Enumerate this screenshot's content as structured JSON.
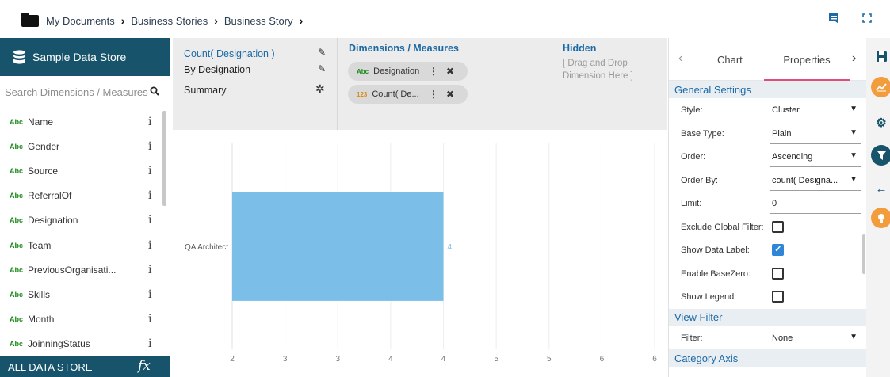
{
  "breadcrumb": [
    "My Documents",
    "Business Stories",
    "Business Story"
  ],
  "left_panel": {
    "store_title": "Sample Data Store",
    "search_placeholder": "Search Dimensions / Measures",
    "fields": [
      {
        "type": "Abc",
        "name": "Name"
      },
      {
        "type": "Abc",
        "name": "Gender"
      },
      {
        "type": "Abc",
        "name": "Source"
      },
      {
        "type": "Abc",
        "name": "ReferralOf"
      },
      {
        "type": "Abc",
        "name": "Designation"
      },
      {
        "type": "Abc",
        "name": "Team"
      },
      {
        "type": "Abc",
        "name": "PreviousOrganisati..."
      },
      {
        "type": "Abc",
        "name": "Skills"
      },
      {
        "type": "Abc",
        "name": "Month"
      },
      {
        "type": "Abc",
        "name": "JoinningStatus"
      }
    ],
    "info_glyph": "i",
    "footer_label": "ALL DATA STORE",
    "footer_fx": "fx"
  },
  "config": {
    "measure_title": "Count( Designation )",
    "by_label": "By Designation",
    "summary_label": "Summary",
    "dim_title": "Dimensions / Measures",
    "pills": [
      {
        "type": "Abc",
        "label": "Designation"
      },
      {
        "type": "123",
        "label": "Count( De..."
      }
    ],
    "hidden_title": "Hidden",
    "hidden_hint_line1": "[ Drag and Drop",
    "hidden_hint_line2": "Dimension Here ]"
  },
  "chart_data": {
    "type": "bar",
    "orientation": "horizontal",
    "categories": [
      "QA Architect"
    ],
    "values": [
      4
    ],
    "data_labels": [
      "4"
    ],
    "x_ticks": [
      "2",
      "3",
      "3",
      "4",
      "4",
      "5",
      "5",
      "6",
      "6"
    ],
    "xlim": [
      2,
      6
    ],
    "bar_color": "#7bbfe8",
    "title": "",
    "xlabel": "",
    "ylabel": "",
    "grid": true
  },
  "properties": {
    "tabs": {
      "chart": "Chart",
      "properties": "Properties"
    },
    "general_settings": "General Settings",
    "style": {
      "label": "Style:",
      "value": "Cluster"
    },
    "base_type": {
      "label": "Base Type:",
      "value": "Plain"
    },
    "order": {
      "label": "Order:",
      "value": "Ascending"
    },
    "order_by": {
      "label": "Order By:",
      "value": "count( Designa..."
    },
    "limit": {
      "label": "Limit:",
      "value": "0"
    },
    "exclude_global_filter": {
      "label": "Exclude Global Filter:",
      "checked": false
    },
    "show_data_label": {
      "label": "Show Data Label:",
      "checked": true
    },
    "enable_basezero": {
      "label": "Enable BaseZero:",
      "checked": false
    },
    "show_legend": {
      "label": "Show Legend:",
      "checked": false
    },
    "view_filter": "View Filter",
    "filter": {
      "label": "Filter:",
      "value": "None"
    },
    "category_axis": "Category Axis"
  },
  "colors": {
    "brand": "#17536a",
    "accent": "#1b6aa5",
    "tab_underline": "#e24b7a",
    "checkbox": "#2f86d6"
  }
}
